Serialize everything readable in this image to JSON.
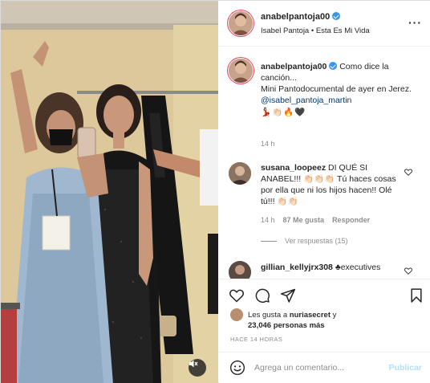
{
  "header": {
    "username": "anabelpantoja00",
    "subtitle": "Isabel Pantoja • Esta Es Mi Vida",
    "more_icon": "more-horizontal-icon"
  },
  "caption": {
    "username": "anabelpantoja00",
    "text_1": "Como dice la canción...",
    "text_2": "Mini Pantodocumental de ayer en Jerez.",
    "mention": "@isabel_pantoja_martin",
    "emojis": "💃🏻👏🏻🔥🖤",
    "time": "14 h"
  },
  "comment_1": {
    "username": "susana_loopeez",
    "text": "DI QUÉ SI ANABEL!!! 👏🏻👏🏻👏🏻 Tú haces cosas por ella que ni los hijos hacen!! Olé tú!!! 👏🏻👏🏻",
    "time": "14 h",
    "likes": "87 Me gusta",
    "reply": "Responder",
    "view_replies": "Ver respuestas (15)"
  },
  "comment_2": {
    "username": "gillian_kellyjrx308",
    "text": "♣︎executives"
  },
  "actions": {
    "like_icon": "heart-icon",
    "comment_icon": "comment-icon",
    "share_icon": "paper-plane-icon",
    "save_icon": "bookmark-icon"
  },
  "likes": {
    "prefix": "Les gusta a ",
    "user": "nuriasecret",
    "middle": " y",
    "count": "23,046 personas más"
  },
  "time_ago": "HACE 14 HORAS",
  "composer": {
    "placeholder": "Agrega un comentario...",
    "post_label": "Publicar"
  },
  "video": {
    "mute_icon": "speaker-muted-icon"
  }
}
